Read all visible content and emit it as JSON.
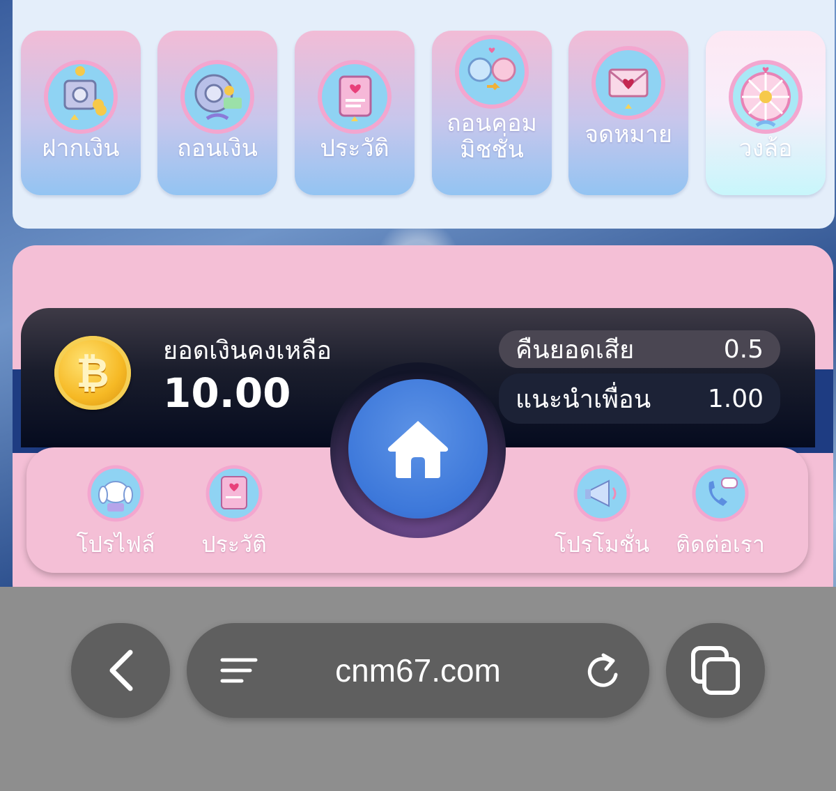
{
  "top_menu": {
    "items": [
      {
        "label": "ฝากเงิน",
        "icon": "safe-icon"
      },
      {
        "label": "ถอนเงิน",
        "icon": "vault-money-icon"
      },
      {
        "label": "ประวัติ",
        "icon": "notebook-icon"
      },
      {
        "label": "ถอนคอมมิชชั่น",
        "icon": "friends-icon"
      },
      {
        "label": "จดหมาย",
        "icon": "mail-heart-icon"
      },
      {
        "label": "วงล้อ",
        "icon": "wheel-icon",
        "active": true
      }
    ]
  },
  "balance": {
    "label": "ยอดเงินคงเหลือ",
    "value": "10.00",
    "coin_symbol": "₿"
  },
  "stats": {
    "cashback": {
      "label": "คืนยอดเสีย",
      "value": "0.5"
    },
    "referral": {
      "label": "แนะนำเพื่อน",
      "value": "1.00"
    }
  },
  "bottom_nav": {
    "profile": "โปรไฟล์",
    "history": "ประวัติ",
    "promotion": "โปรโมชั่น",
    "contact": "ติดต่อเรา"
  },
  "browser": {
    "url": "cnm67.com"
  },
  "colors": {
    "pink_panel": "#f4bfd6",
    "home_blue": "#3d78da",
    "dark_bar": "#050b1f"
  }
}
